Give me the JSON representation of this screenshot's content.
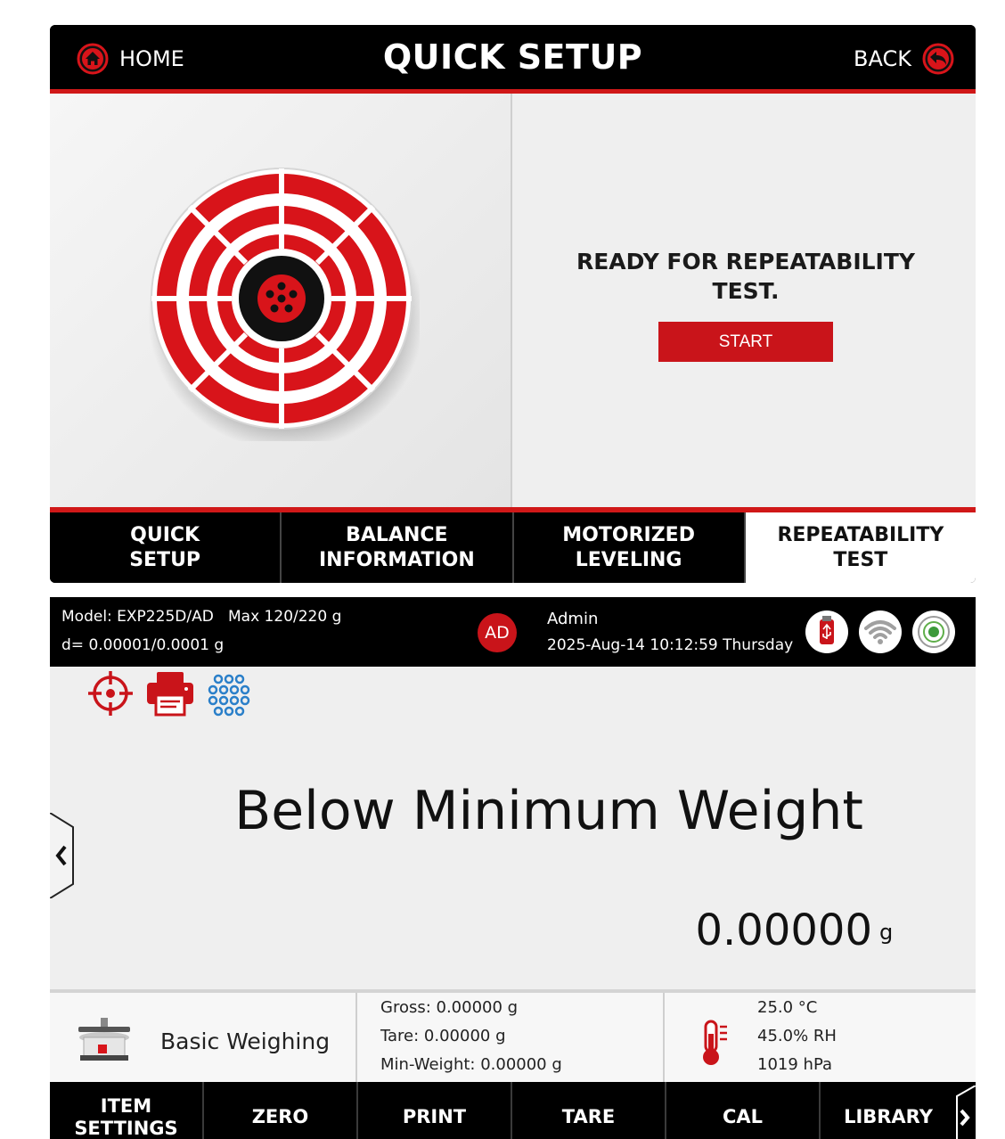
{
  "quick_setup": {
    "header": {
      "home_label": "HOME",
      "title": "QUICK SETUP",
      "back_label": "BACK"
    },
    "message": "READY FOR REPEATABILITY TEST.",
    "start_label": "START",
    "tabs": [
      {
        "label": "QUICK\nSETUP",
        "active": false
      },
      {
        "label": "BALANCE\nINFORMATION",
        "active": false
      },
      {
        "label": "MOTORIZED\nLEVELING",
        "active": false
      },
      {
        "label": "REPEATABILITY\nTEST",
        "active": true
      }
    ],
    "icons": {
      "home": "home-icon",
      "back": "back-arrow-icon",
      "illustration": "target-illustration"
    }
  },
  "weighing": {
    "header": {
      "model": "Model: EXP225D/AD   Max 120/220 g",
      "readability": "d= 0.00001/0.0001 g",
      "avatar_initials": "AD",
      "user": "Admin",
      "datetime": "2025-Aug-14 10:12:59 Thursday"
    },
    "status_icons": [
      "usb-icon",
      "wifi-icon",
      "level-icon"
    ],
    "toolbar_icons": [
      "target-icon",
      "printer-icon",
      "keypad-icon"
    ],
    "message": "Below Minimum Weight",
    "weight_value": "0.00000",
    "weight_unit": "g",
    "application": {
      "label": "Basic Weighing",
      "icon": "balance-icon"
    },
    "readings": {
      "gross": "Gross: 0.00000 g",
      "tare": "Tare: 0.00000 g",
      "min_weight": "Min-Weight: 0.00000 g"
    },
    "environment": {
      "temperature": "25.0 °C",
      "humidity": "45.0% RH",
      "pressure": "1019 hPa",
      "icon": "thermometer-icon"
    },
    "buttons": [
      {
        "label": "ITEM\nSETTINGS"
      },
      {
        "label": "ZERO"
      },
      {
        "label": "PRINT"
      },
      {
        "label": "TARE"
      },
      {
        "label": "CAL"
      },
      {
        "label": "LIBRARY"
      }
    ]
  },
  "colors": {
    "accent_red": "#c9141a",
    "header_black": "#000000",
    "keypad_blue": "#2a7fc9"
  }
}
